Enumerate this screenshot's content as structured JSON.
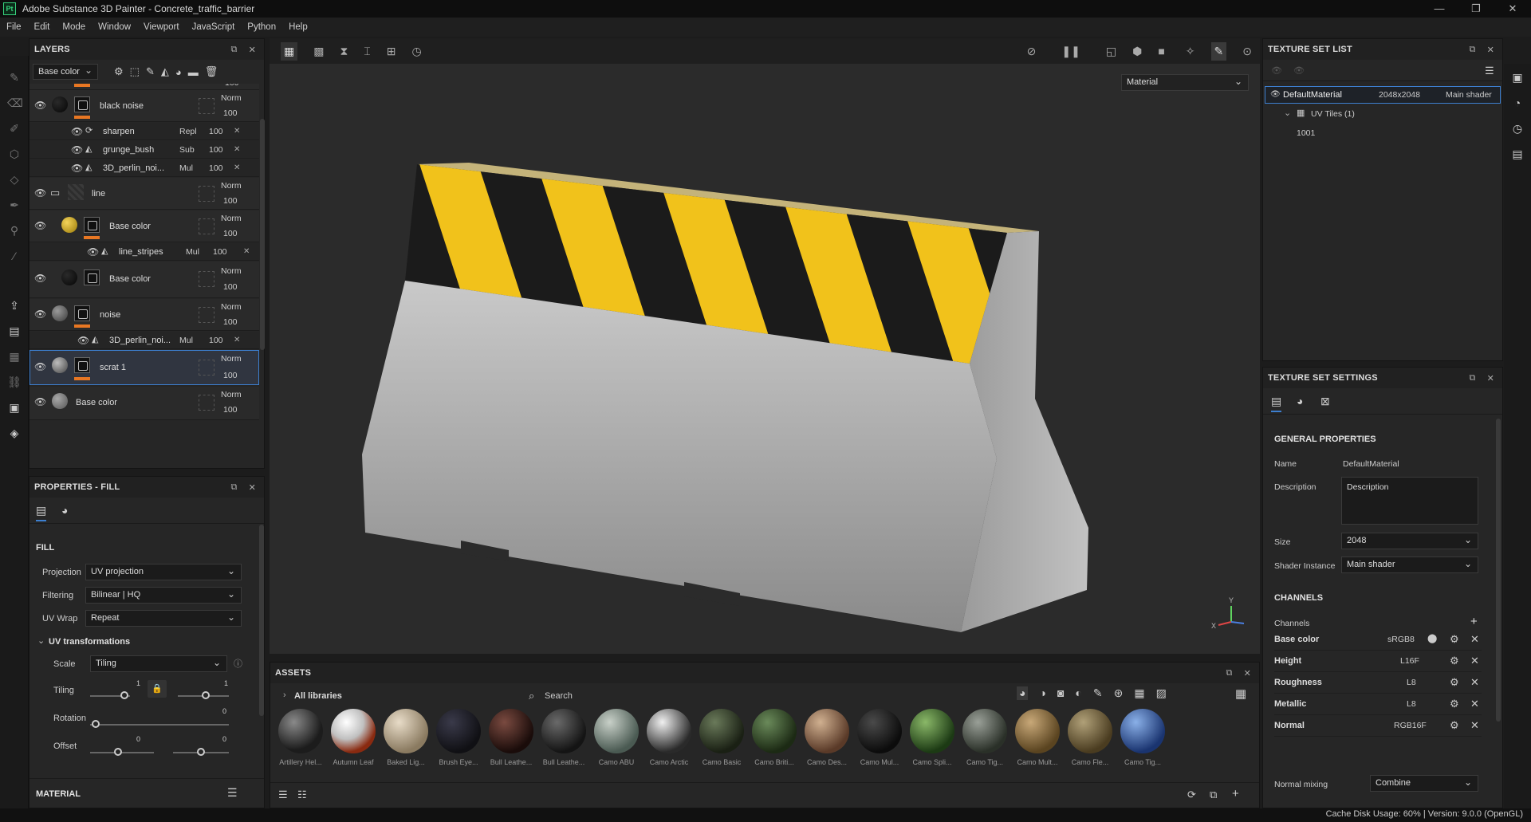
{
  "window": {
    "title": "Adobe Substance 3D Painter - Concrete_traffic_barrier",
    "app_badge": "Pt",
    "minimize": "—",
    "maximize": "❐",
    "close": "✕"
  },
  "menu": [
    "File",
    "Edit",
    "Mode",
    "Window",
    "Viewport",
    "JavaScript",
    "Python",
    "Help"
  ],
  "layers": {
    "title": "LAYERS",
    "channel_select": "Base color",
    "top_value": "100",
    "rows": [
      {
        "name": "black noise",
        "blend": "Norm",
        "opacity": "100"
      },
      {
        "name": "sharpen",
        "blend": "Repl",
        "opacity": "100"
      },
      {
        "name": "grunge_bush",
        "blend": "Sub",
        "opacity": "100"
      },
      {
        "name": "3D_perlin_noi...",
        "blend": "Mul",
        "opacity": "100"
      },
      {
        "name": "line",
        "blend": "Norm",
        "opacity": "100"
      },
      {
        "name": "Base color",
        "blend": "Norm",
        "opacity": "100"
      },
      {
        "name": "line_stripes",
        "blend": "Mul",
        "opacity": "100"
      },
      {
        "name": "Base color",
        "blend": "Norm",
        "opacity": "100"
      },
      {
        "name": "noise",
        "blend": "Norm",
        "opacity": "100"
      },
      {
        "name": "3D_perlin_noi...",
        "blend": "Mul",
        "opacity": "100"
      },
      {
        "name": "scrat 1",
        "blend": "Norm",
        "opacity": "100"
      },
      {
        "name": "Base color",
        "blend": "Norm",
        "opacity": "100"
      }
    ]
  },
  "properties": {
    "title": "PROPERTIES - FILL",
    "fill_title": "FILL",
    "projection_label": "Projection",
    "projection_value": "UV projection",
    "filtering_label": "Filtering",
    "filtering_value": "Bilinear | HQ",
    "uvwrap_label": "UV Wrap",
    "uvwrap_value": "Repeat",
    "uvtrans_title": "UV transformations",
    "scale_label": "Scale",
    "scale_value": "Tiling",
    "tiling_label": "Tiling",
    "tiling_a": "1",
    "tiling_b": "1",
    "rotation_label": "Rotation",
    "rotation_value": "0",
    "offset_label": "Offset",
    "offset_a": "0",
    "offset_b": "0",
    "material_title": "MATERIAL"
  },
  "viewport": {
    "mode_select": "Material",
    "axis_y": "Y",
    "axis_x": "X"
  },
  "texture_set_list": {
    "title": "TEXTURE SET LIST",
    "item_name": "DefaultMaterial",
    "item_res": "2048x2048",
    "item_shader": "Main shader",
    "uv_tiles": "UV Tiles (1)",
    "tile": "1001"
  },
  "texture_set_settings": {
    "title": "TEXTURE SET SETTINGS",
    "general_title": "GENERAL PROPERTIES",
    "name_label": "Name",
    "name_value": "DefaultMaterial",
    "desc_label": "Description",
    "desc_value": "Description",
    "size_label": "Size",
    "size_value": "2048",
    "shader_label": "Shader Instance",
    "shader_value": "Main shader",
    "channels_title": "CHANNELS",
    "channels_label": "Channels",
    "channels": [
      {
        "name": "Base color",
        "format": "sRGB8"
      },
      {
        "name": "Height",
        "format": "L16F"
      },
      {
        "name": "Roughness",
        "format": "L8"
      },
      {
        "name": "Metallic",
        "format": "L8"
      },
      {
        "name": "Normal",
        "format": "RGB16F"
      }
    ],
    "normal_mixing_label": "Normal mixing",
    "normal_mixing_value": "Combine"
  },
  "assets": {
    "title": "ASSETS",
    "all_libraries": "All libraries",
    "search_placeholder": "Search",
    "items": [
      "Artillery Hel...",
      "Autumn Leaf",
      "Baked Lig...",
      "Brush Eye...",
      "Bull Leathe...",
      "Bull Leathe...",
      "Camo ABU",
      "Camo Arctic",
      "Camo Basic",
      "Camo Briti...",
      "Camo Des...",
      "Camo Mul...",
      "Camo Spli...",
      "Camo Tig...",
      "Camo Mult...",
      "Camo Fle...",
      "Camo Tig..."
    ]
  },
  "status": {
    "text": "Cache Disk Usage:   60% | Version: 9.0.0 (OpenGL)"
  },
  "colors": {
    "accent": "#3d7fcf",
    "orange": "#e87723",
    "yellow": "#f1c21b"
  }
}
